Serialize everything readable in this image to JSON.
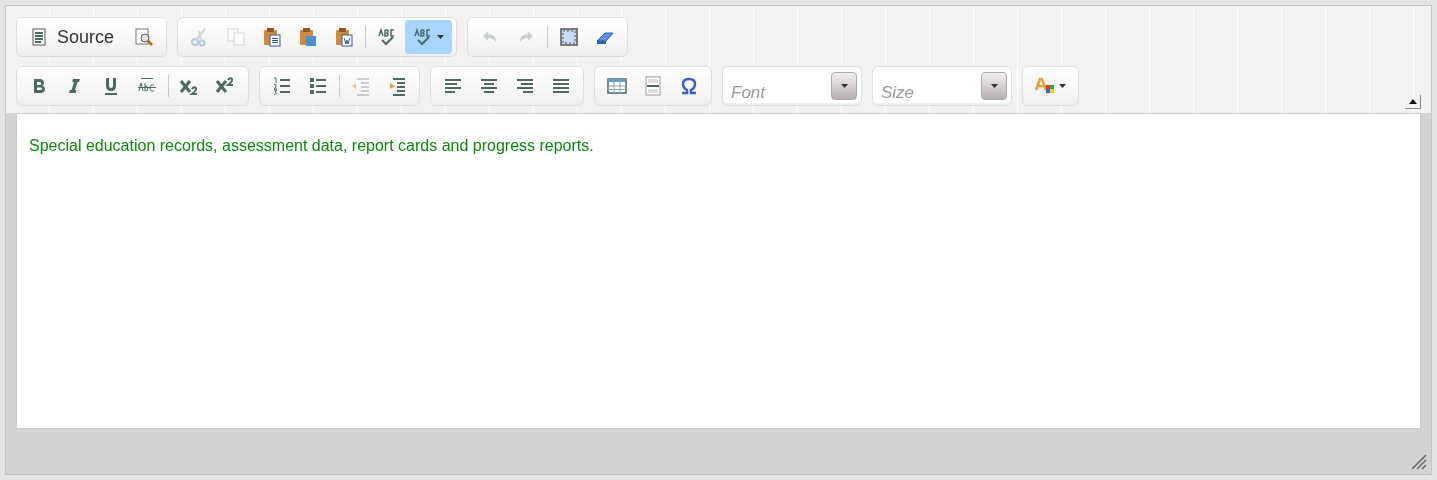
{
  "toolbar": {
    "rows": [
      [
        {
          "items": [
            {
              "kind": "button",
              "label": "Source",
              "disabled": false,
              "selected": false
            },
            {
              "kind": "button",
              "disabled": false,
              "selected": false
            }
          ]
        },
        {
          "items": [
            {
              "kind": "button",
              "disabled": true,
              "selected": false
            },
            {
              "kind": "button",
              "disabled": true,
              "selected": false
            },
            {
              "kind": "button",
              "disabled": false,
              "selected": false
            },
            {
              "kind": "button",
              "disabled": false,
              "selected": false
            },
            {
              "kind": "button",
              "disabled": false,
              "selected": false
            },
            {
              "kind": "separator"
            },
            {
              "kind": "button",
              "disabled": false,
              "selected": false
            },
            {
              "kind": "menu",
              "disabled": false,
              "selected": true
            }
          ]
        },
        {
          "items": [
            {
              "kind": "button",
              "disabled": true,
              "selected": false
            },
            {
              "kind": "button",
              "disabled": true,
              "selected": false
            },
            {
              "kind": "separator"
            },
            {
              "kind": "button",
              "disabled": false,
              "selected": false
            },
            {
              "kind": "button",
              "disabled": false,
              "selected": false
            }
          ]
        }
      ],
      [
        {
          "items": [
            {
              "kind": "button",
              "disabled": false,
              "selected": false
            },
            {
              "kind": "button",
              "disabled": false,
              "selected": false
            },
            {
              "kind": "button",
              "disabled": false,
              "selected": false
            },
            {
              "kind": "button",
              "disabled": false,
              "selected": false
            },
            {
              "kind": "separator"
            },
            {
              "kind": "button",
              "disabled": false,
              "selected": false
            },
            {
              "kind": "button",
              "disabled": false,
              "selected": false
            }
          ]
        },
        {
          "items": [
            {
              "kind": "button",
              "disabled": false,
              "selected": false
            },
            {
              "kind": "button",
              "disabled": false,
              "selected": false
            },
            {
              "kind": "separator"
            },
            {
              "kind": "button",
              "disabled": true,
              "selected": false
            },
            {
              "kind": "button",
              "disabled": false,
              "selected": false
            }
          ]
        },
        {
          "items": [
            {
              "kind": "button",
              "disabled": false,
              "selected": false
            },
            {
              "kind": "button",
              "disabled": false,
              "selected": false
            },
            {
              "kind": "button",
              "disabled": false,
              "selected": false
            },
            {
              "kind": "button",
              "disabled": false,
              "selected": false
            }
          ]
        },
        {
          "items": [
            {
              "kind": "button",
              "disabled": false,
              "selected": false
            },
            {
              "kind": "button",
              "disabled": false,
              "selected": false
            },
            {
              "kind": "button",
              "disabled": false,
              "selected": false
            }
          ]
        },
        {
          "items": [
            {
              "kind": "combo",
              "placeholder": "Font"
            }
          ]
        },
        {
          "items": [
            {
              "kind": "combo",
              "placeholder": "Size"
            }
          ]
        },
        {
          "items": [
            {
              "kind": "menu",
              "disabled": false,
              "selected": false
            }
          ]
        }
      ]
    ]
  },
  "content": {
    "text": "Special education records, assessment data, report cards and progress reports."
  }
}
